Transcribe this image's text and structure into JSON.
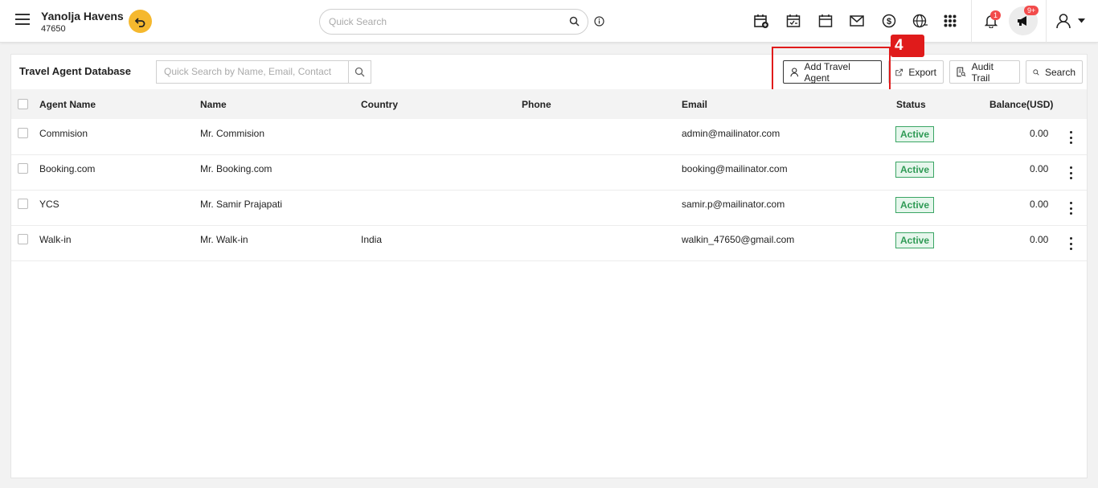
{
  "header": {
    "property_name": "Yanolja Havens",
    "property_code": "47650",
    "search_placeholder": "Quick Search",
    "notification_count": "1",
    "announcement_count": "9+"
  },
  "icons": [
    "menu-icon",
    "undo-icon",
    "search-icon",
    "info-icon",
    "calendar-add-icon",
    "calendar-check-icon",
    "calendar-icon",
    "mail-icon",
    "dollar-icon",
    "globe-icon",
    "apps-grid-icon",
    "bell-icon",
    "megaphone-icon",
    "user-icon",
    "chevron-down-icon"
  ],
  "colors": {
    "accent": "#f5b82e",
    "badge": "#f24b4b",
    "status_green": "#2f9a55",
    "highlight": "#e01b1b"
  },
  "page": {
    "title": "Travel Agent Database",
    "search_placeholder": "Quick Search by Name, Email, Contact",
    "buttons": {
      "add": "Add Travel Agent",
      "export": "Export",
      "audit": "Audit Trail",
      "search": "Search"
    },
    "step_marker": "4"
  },
  "table": {
    "columns": [
      "Agent Name",
      "Name",
      "Country",
      "Phone",
      "Email",
      "Status",
      "Balance(USD)"
    ],
    "rows": [
      {
        "agent": "Commision",
        "name": "Mr. Commision",
        "country": "",
        "phone": "",
        "email": "admin@mailinator.com",
        "status": "Active",
        "balance": "0.00"
      },
      {
        "agent": "Booking.com",
        "name": "Mr. Booking.com",
        "country": "",
        "phone": "",
        "email": "booking@mailinator.com",
        "status": "Active",
        "balance": "0.00"
      },
      {
        "agent": "YCS",
        "name": "Mr. Samir Prajapati",
        "country": "",
        "phone": "",
        "email": "samir.p@mailinator.com",
        "status": "Active",
        "balance": "0.00"
      },
      {
        "agent": "Walk-in",
        "name": "Mr. Walk-in",
        "country": "India",
        "phone": "",
        "email": "walkin_47650@gmail.com",
        "status": "Active",
        "balance": "0.00"
      }
    ]
  }
}
